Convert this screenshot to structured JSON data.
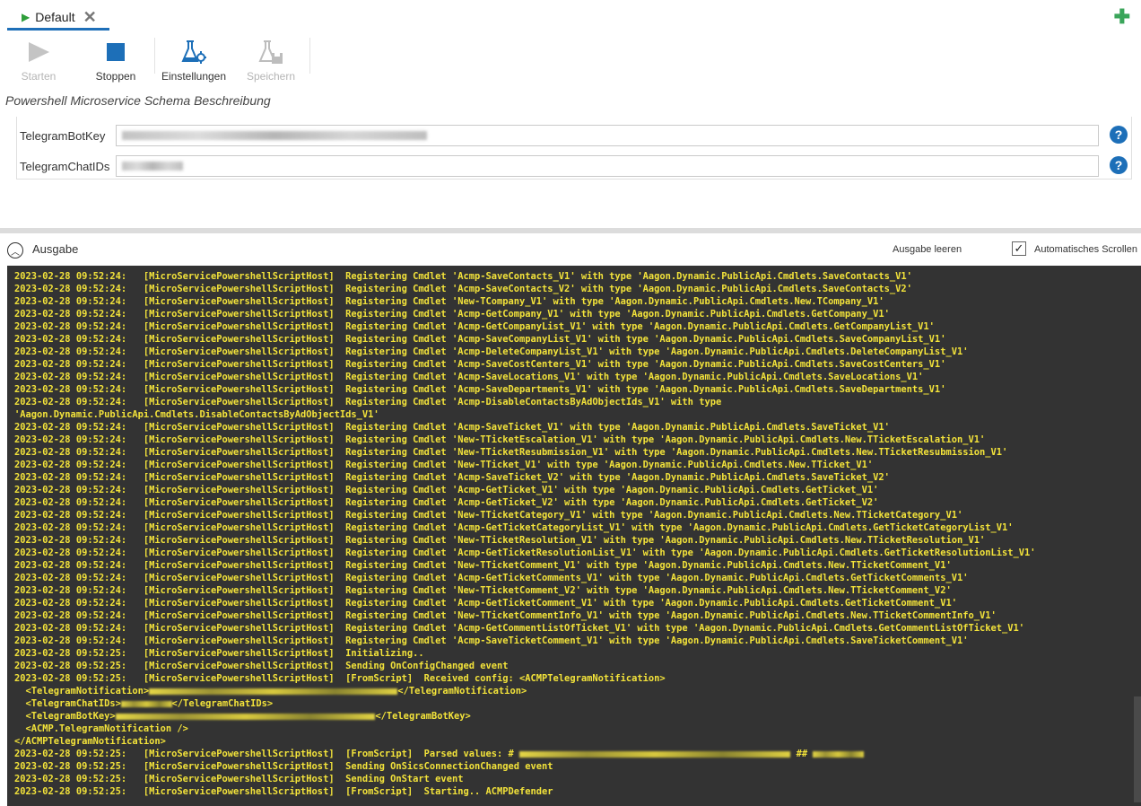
{
  "tab": {
    "label": "Default"
  },
  "toolbar": {
    "start_label": "Starten",
    "stop_label": "Stoppen",
    "settings_label": "Einstellungen",
    "save_label": "Speichern"
  },
  "schema_description": "Powershell Microservice Schema Beschreibung",
  "fields": [
    {
      "label": "TelegramBotKey"
    },
    {
      "label": "TelegramChatIDs"
    }
  ],
  "output": {
    "title": "Ausgabe",
    "clear_label": "Ausgabe leeren",
    "autoscroll_label": "Automatisches Scrollen",
    "autoscroll_checked": true
  },
  "console_lines": [
    "2023-02-28 09:52:24:   [MicroServicePowershellScriptHost]  Registering Cmdlet 'Acmp-SaveContacts_V1' with type 'Aagon.Dynamic.PublicApi.Cmdlets.SaveContacts_V1'",
    "2023-02-28 09:52:24:   [MicroServicePowershellScriptHost]  Registering Cmdlet 'Acmp-SaveContacts_V2' with type 'Aagon.Dynamic.PublicApi.Cmdlets.SaveContacts_V2'",
    "2023-02-28 09:52:24:   [MicroServicePowershellScriptHost]  Registering Cmdlet 'New-TCompany_V1' with type 'Aagon.Dynamic.PublicApi.Cmdlets.New.TCompany_V1'",
    "2023-02-28 09:52:24:   [MicroServicePowershellScriptHost]  Registering Cmdlet 'Acmp-GetCompany_V1' with type 'Aagon.Dynamic.PublicApi.Cmdlets.GetCompany_V1'",
    "2023-02-28 09:52:24:   [MicroServicePowershellScriptHost]  Registering Cmdlet 'Acmp-GetCompanyList_V1' with type 'Aagon.Dynamic.PublicApi.Cmdlets.GetCompanyList_V1'",
    "2023-02-28 09:52:24:   [MicroServicePowershellScriptHost]  Registering Cmdlet 'Acmp-SaveCompanyList_V1' with type 'Aagon.Dynamic.PublicApi.Cmdlets.SaveCompanyList_V1'",
    "2023-02-28 09:52:24:   [MicroServicePowershellScriptHost]  Registering Cmdlet 'Acmp-DeleteCompanyList_V1' with type 'Aagon.Dynamic.PublicApi.Cmdlets.DeleteCompanyList_V1'",
    "2023-02-28 09:52:24:   [MicroServicePowershellScriptHost]  Registering Cmdlet 'Acmp-SaveCostCenters_V1' with type 'Aagon.Dynamic.PublicApi.Cmdlets.SaveCostCenters_V1'",
    "2023-02-28 09:52:24:   [MicroServicePowershellScriptHost]  Registering Cmdlet 'Acmp-SaveLocations_V1' with type 'Aagon.Dynamic.PublicApi.Cmdlets.SaveLocations_V1'",
    "2023-02-28 09:52:24:   [MicroServicePowershellScriptHost]  Registering Cmdlet 'Acmp-SaveDepartments_V1' with type 'Aagon.Dynamic.PublicApi.Cmdlets.SaveDepartments_V1'",
    "2023-02-28 09:52:24:   [MicroServicePowershellScriptHost]  Registering Cmdlet 'Acmp-DisableContactsByAdObjectIds_V1' with type",
    "'Aagon.Dynamic.PublicApi.Cmdlets.DisableContactsByAdObjectIds_V1'",
    "2023-02-28 09:52:24:   [MicroServicePowershellScriptHost]  Registering Cmdlet 'Acmp-SaveTicket_V1' with type 'Aagon.Dynamic.PublicApi.Cmdlets.SaveTicket_V1'",
    "2023-02-28 09:52:24:   [MicroServicePowershellScriptHost]  Registering Cmdlet 'New-TTicketEscalation_V1' with type 'Aagon.Dynamic.PublicApi.Cmdlets.New.TTicketEscalation_V1'",
    "2023-02-28 09:52:24:   [MicroServicePowershellScriptHost]  Registering Cmdlet 'New-TTicketResubmission_V1' with type 'Aagon.Dynamic.PublicApi.Cmdlets.New.TTicketResubmission_V1'",
    "2023-02-28 09:52:24:   [MicroServicePowershellScriptHost]  Registering Cmdlet 'New-TTicket_V1' with type 'Aagon.Dynamic.PublicApi.Cmdlets.New.TTicket_V1'",
    "2023-02-28 09:52:24:   [MicroServicePowershellScriptHost]  Registering Cmdlet 'Acmp-SaveTicket_V2' with type 'Aagon.Dynamic.PublicApi.Cmdlets.SaveTicket_V2'",
    "2023-02-28 09:52:24:   [MicroServicePowershellScriptHost]  Registering Cmdlet 'Acmp-GetTicket_V1' with type 'Aagon.Dynamic.PublicApi.Cmdlets.GetTicket_V1'",
    "2023-02-28 09:52:24:   [MicroServicePowershellScriptHost]  Registering Cmdlet 'Acmp-GetTicket_V2' with type 'Aagon.Dynamic.PublicApi.Cmdlets.GetTicket_V2'",
    "2023-02-28 09:52:24:   [MicroServicePowershellScriptHost]  Registering Cmdlet 'New-TTicketCategory_V1' with type 'Aagon.Dynamic.PublicApi.Cmdlets.New.TTicketCategory_V1'",
    "2023-02-28 09:52:24:   [MicroServicePowershellScriptHost]  Registering Cmdlet 'Acmp-GetTicketCategoryList_V1' with type 'Aagon.Dynamic.PublicApi.Cmdlets.GetTicketCategoryList_V1'",
    "2023-02-28 09:52:24:   [MicroServicePowershellScriptHost]  Registering Cmdlet 'New-TTicketResolution_V1' with type 'Aagon.Dynamic.PublicApi.Cmdlets.New.TTicketResolution_V1'",
    "2023-02-28 09:52:24:   [MicroServicePowershellScriptHost]  Registering Cmdlet 'Acmp-GetTicketResolutionList_V1' with type 'Aagon.Dynamic.PublicApi.Cmdlets.GetTicketResolutionList_V1'",
    "2023-02-28 09:52:24:   [MicroServicePowershellScriptHost]  Registering Cmdlet 'New-TTicketComment_V1' with type 'Aagon.Dynamic.PublicApi.Cmdlets.New.TTicketComment_V1'",
    "2023-02-28 09:52:24:   [MicroServicePowershellScriptHost]  Registering Cmdlet 'Acmp-GetTicketComments_V1' with type 'Aagon.Dynamic.PublicApi.Cmdlets.GetTicketComments_V1'",
    "2023-02-28 09:52:24:   [MicroServicePowershellScriptHost]  Registering Cmdlet 'New-TTicketComment_V2' with type 'Aagon.Dynamic.PublicApi.Cmdlets.New.TTicketComment_V2'",
    "2023-02-28 09:52:24:   [MicroServicePowershellScriptHost]  Registering Cmdlet 'Acmp-GetTicketComment_V1' with type 'Aagon.Dynamic.PublicApi.Cmdlets.GetTicketComment_V1'",
    "2023-02-28 09:52:24:   [MicroServicePowershellScriptHost]  Registering Cmdlet 'New-TTicketCommentInfo_V1' with type 'Aagon.Dynamic.PublicApi.Cmdlets.New.TTicketCommentInfo_V1'",
    "2023-02-28 09:52:24:   [MicroServicePowershellScriptHost]  Registering Cmdlet 'Acmp-GetCommentListOfTicket_V1' with type 'Aagon.Dynamic.PublicApi.Cmdlets.GetCommentListOfTicket_V1'",
    "2023-02-28 09:52:24:   [MicroServicePowershellScriptHost]  Registering Cmdlet 'Acmp-SaveTicketComment_V1' with type 'Aagon.Dynamic.PublicApi.Cmdlets.SaveTicketComment_V1'",
    "2023-02-28 09:52:25:   [MicroServicePowershellScriptHost]  Initializing..",
    "2023-02-28 09:52:25:   [MicroServicePowershellScriptHost]  Sending OnConfigChanged event",
    "2023-02-28 09:52:25:   [MicroServicePowershellScriptHost]  [FromScript]  Received config: <ACMPTelegramNotification>",
    "  <TelegramNotification>{B:44}</TelegramNotification>",
    "  <TelegramChatIDs>{B:9}</TelegramChatIDs>",
    "  <TelegramBotKey>{B:46}</TelegramBotKey>",
    "  <ACMP.TelegramNotification />",
    "</ACMPTelegramNotification>",
    "2023-02-28 09:52:25:   [MicroServicePowershellScriptHost]  [FromScript]  Parsed values: # {B:48} ## {B:9}",
    "2023-02-28 09:52:25:   [MicroServicePowershellScriptHost]  Sending OnSicsConnectionChanged event",
    "2023-02-28 09:52:25:   [MicroServicePowershellScriptHost]  Sending OnStart event",
    "2023-02-28 09:52:25:   [MicroServicePowershellScriptHost]  [FromScript]  Starting.. ACMPDefender"
  ]
}
